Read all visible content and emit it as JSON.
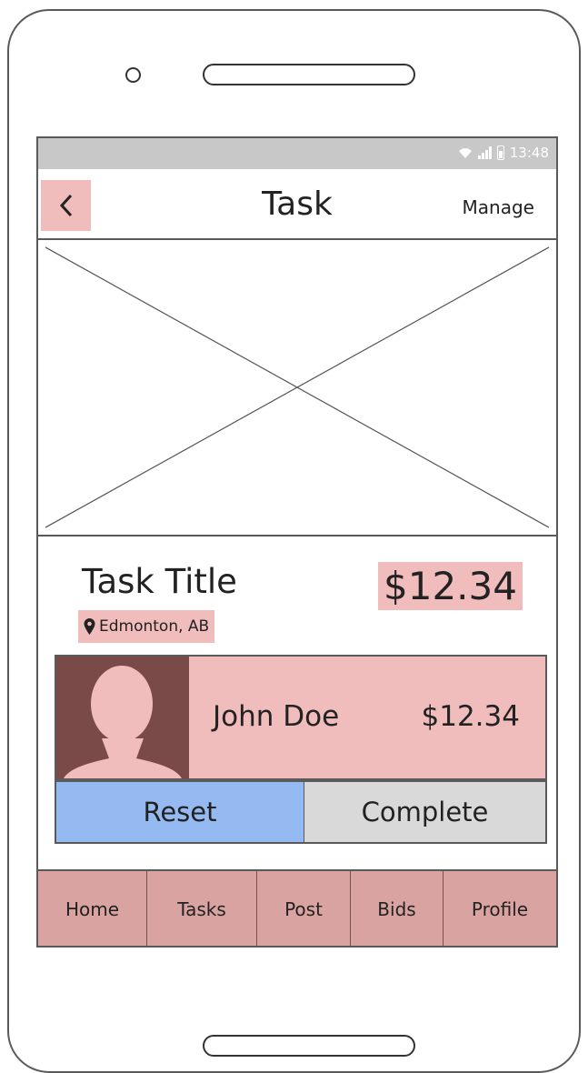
{
  "status_bar": {
    "time": "13:48"
  },
  "nav": {
    "title": "Task",
    "manage_label": "Manage"
  },
  "task": {
    "title": "Task Title",
    "price": "$12.34",
    "location": "Edmonton, AB"
  },
  "bid": {
    "bidder_name": "John Doe",
    "amount": "$12.34"
  },
  "actions": {
    "reset_label": "Reset",
    "complete_label": "Complete"
  },
  "tabs": [
    {
      "label": "Home"
    },
    {
      "label": "Tasks"
    },
    {
      "label": "Post"
    },
    {
      "label": "Bids"
    },
    {
      "label": "Profile"
    }
  ],
  "colors": {
    "highlight": "#f1bcbc",
    "avatar_bg": "#7a4a48",
    "reset_bg": "#94baf1",
    "complete_bg": "#d9d9d9",
    "tab_bg": "#d9a3a1",
    "status_bg": "#c8c8c8"
  }
}
